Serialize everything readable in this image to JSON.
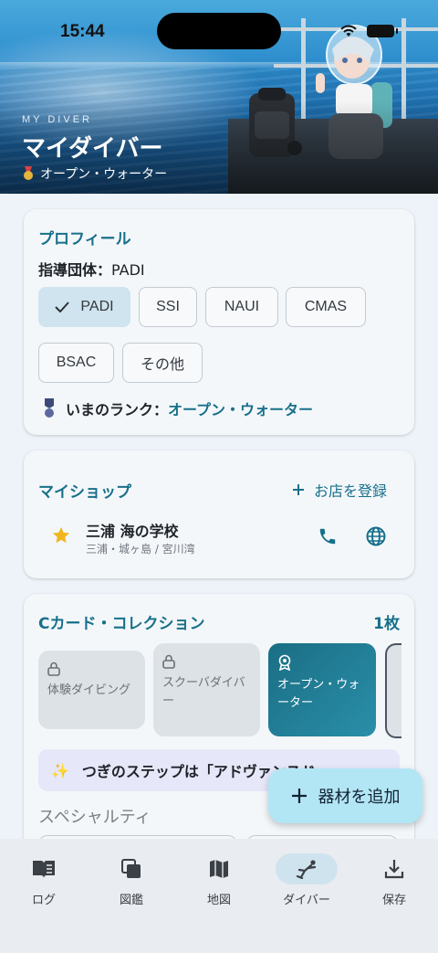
{
  "status": {
    "time": "15:44"
  },
  "hero": {
    "subtitle": "MY DIVER",
    "title": "マイダイバー",
    "rank": "オープン・ウォーター"
  },
  "profile": {
    "title": "プロフィール",
    "org_label": "指導団体：",
    "org_value": "PADI",
    "orgs": [
      "PADI",
      "SSI",
      "NAUI",
      "CMAS",
      "BSAC",
      "その他"
    ],
    "selected_org": "PADI",
    "rank_label": "いまのランク：",
    "rank_value": "オープン・ウォーター"
  },
  "shop": {
    "title": "マイショップ",
    "add_label": "お店を登録",
    "name": "三浦 海の学校",
    "location": "三浦・城ヶ島 / 宮川湾"
  },
  "ccards": {
    "title": "Cカード・コレクション",
    "count": "1枚",
    "items": [
      {
        "label": "体験ダイビング",
        "state": "locked"
      },
      {
        "label": "スクーバダイバー",
        "state": "locked"
      },
      {
        "label": "オープン・ウォーター",
        "state": "owned"
      }
    ],
    "next_step": "つぎのステップは「アドヴァンスド・",
    "specialty_title": "スペシャルティ"
  },
  "fab": {
    "label": "器材を追加"
  },
  "nav": {
    "items": [
      {
        "label": "ログ",
        "icon": "book-icon"
      },
      {
        "label": "図鑑",
        "icon": "stack-icon"
      },
      {
        "label": "地図",
        "icon": "map-icon"
      },
      {
        "label": "ダイバー",
        "icon": "diver-icon"
      },
      {
        "label": "保存",
        "icon": "download-icon"
      }
    ],
    "active": "ダイバー"
  },
  "colors": {
    "accent": "#17708a",
    "chip_selected": "#d0e4ef",
    "fab": "#b3e6f5"
  }
}
